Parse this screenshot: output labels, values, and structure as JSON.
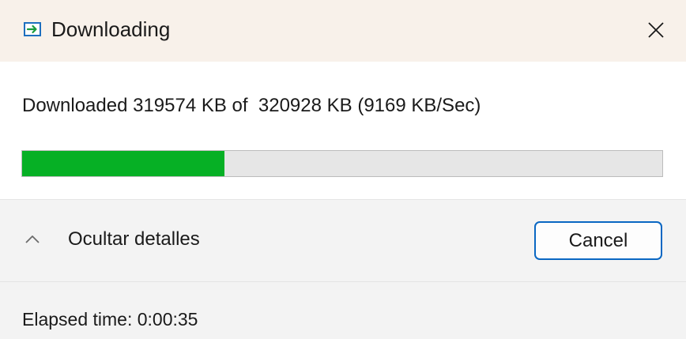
{
  "window": {
    "title": "Downloading",
    "title_icon": "download-arrow-icon",
    "close_icon": "close-icon"
  },
  "status": {
    "text": "Downloaded 319574 KB of  320928 KB (9169 KB/Sec)"
  },
  "progress": {
    "fraction": 0.316,
    "fill_color": "#06b025"
  },
  "details": {
    "toggle_label": "Ocultar detalles",
    "toggle_icon": "chevron-up-icon",
    "cancel_label": "Cancel"
  },
  "footer": {
    "elapsed": "Elapsed time: 0:00:35"
  },
  "colors": {
    "titlebar_bg": "#f8f1ea",
    "accent": "#0a67c3"
  }
}
